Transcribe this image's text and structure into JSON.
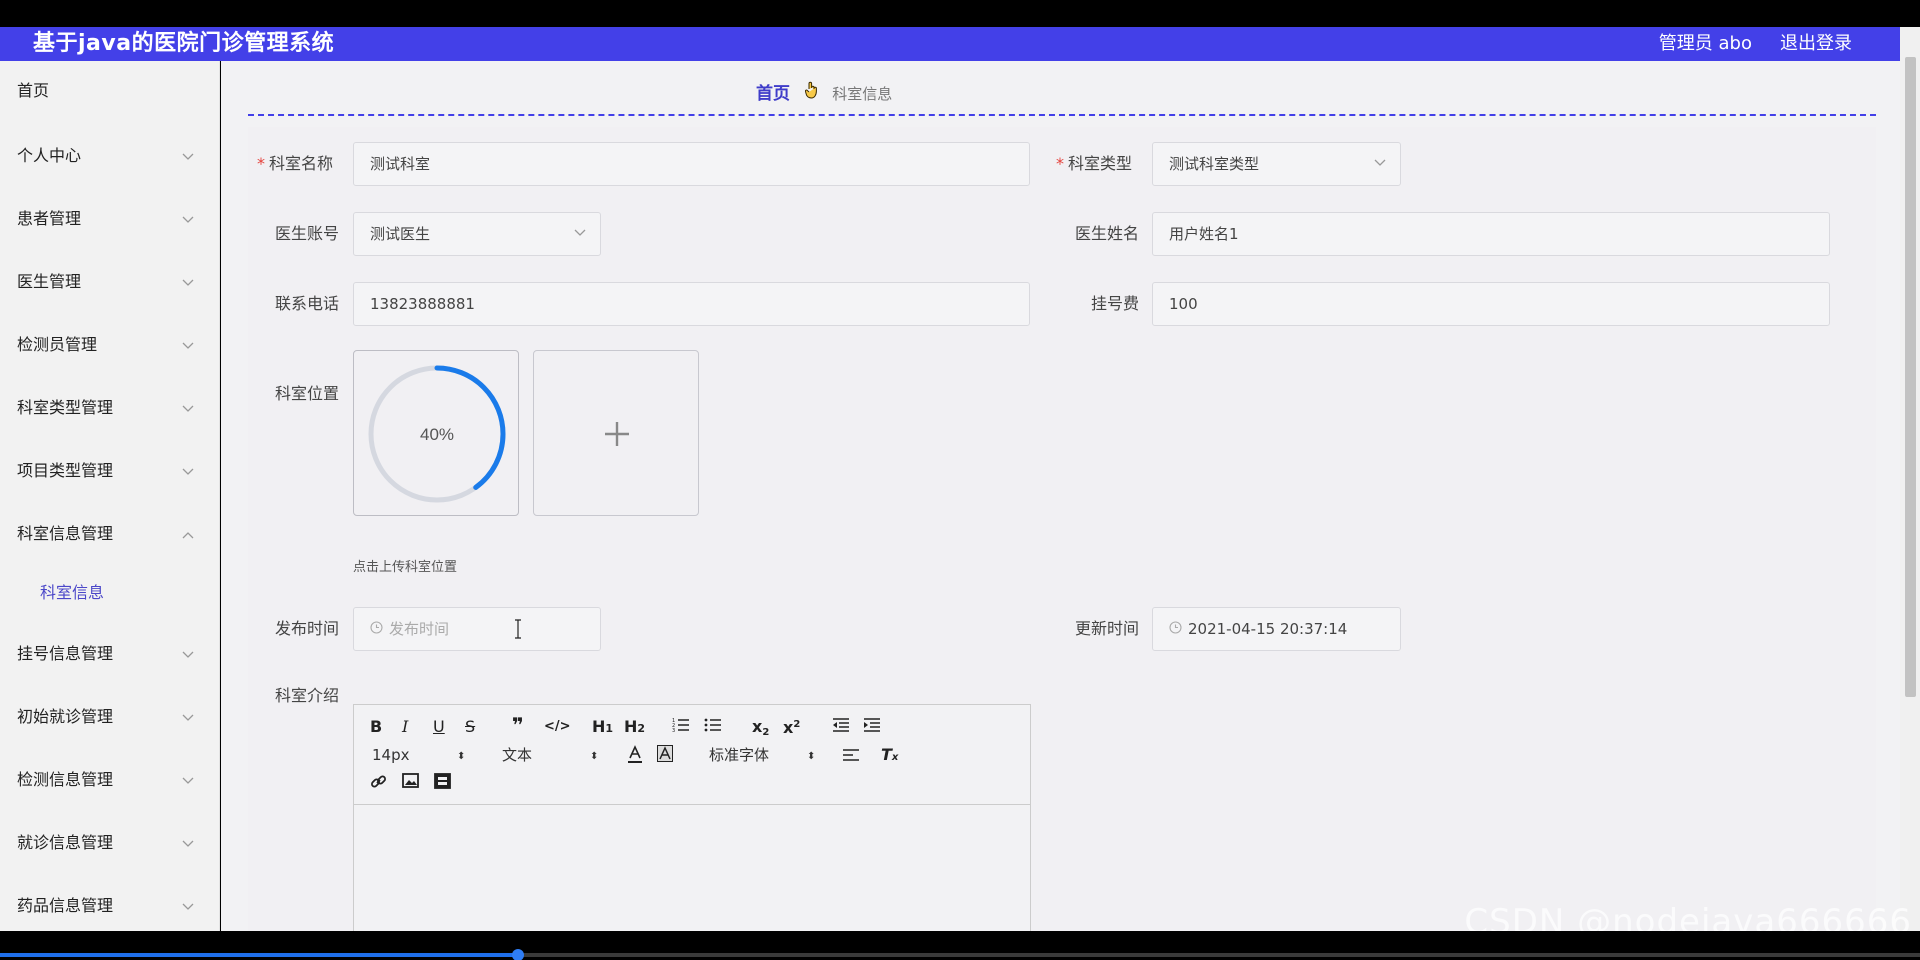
{
  "header": {
    "app_title": "基于java的医院门诊管理系统",
    "admin_label": "管理员 abo",
    "logout_label": "退出登录",
    "brand_color": "#4340e8"
  },
  "sidebar": {
    "items": [
      {
        "label": "首页",
        "expandable": false
      },
      {
        "label": "个人中心",
        "expandable": true
      },
      {
        "label": "患者管理",
        "expandable": true
      },
      {
        "label": "医生管理",
        "expandable": true
      },
      {
        "label": "检测员管理",
        "expandable": true
      },
      {
        "label": "科室类型管理",
        "expandable": true
      },
      {
        "label": "项目类型管理",
        "expandable": true
      },
      {
        "label": "科室信息管理",
        "expandable": true,
        "expanded": true
      },
      {
        "label": "科室信息",
        "sub": true
      },
      {
        "label": "挂号信息管理",
        "expandable": true
      },
      {
        "label": "初始就诊管理",
        "expandable": true
      },
      {
        "label": "检测信息管理",
        "expandable": true
      },
      {
        "label": "就诊信息管理",
        "expandable": true
      },
      {
        "label": "药品信息管理",
        "expandable": true
      }
    ]
  },
  "breadcrumb": {
    "home": "首页",
    "current": "科室信息"
  },
  "form": {
    "dept_name": {
      "label": "科室名称",
      "required": true,
      "value": "测试科室"
    },
    "dept_type": {
      "label": "科室类型",
      "required": true,
      "value": "测试科室类型"
    },
    "doctor_account": {
      "label": "医生账号",
      "value": "测试医生"
    },
    "doctor_name": {
      "label": "医生姓名",
      "value": "用户姓名1"
    },
    "phone": {
      "label": "联系电话",
      "value": "13823888881"
    },
    "fee": {
      "label": "挂号费",
      "value": "100"
    },
    "location": {
      "label": "科室位置",
      "upload_progress_text": "40%",
      "upload_progress": 0.4,
      "tip": "点击上传科室位置"
    },
    "publish_time": {
      "label": "发布时间",
      "placeholder": "发布时间"
    },
    "update_time": {
      "label": "更新时间",
      "value": "2021-04-15 20:37:14"
    },
    "intro": {
      "label": "科室介绍"
    }
  },
  "editor_toolbar": {
    "font_size": "14px",
    "text_style": "文本",
    "font_family": "标准字体",
    "buttons": [
      "bold-icon",
      "italic-icon",
      "underline-icon",
      "strikethrough-icon",
      "blockquote-icon",
      "code-icon",
      "h1-icon",
      "h2-icon",
      "ordered-list-icon",
      "bullet-list-icon",
      "subscript-icon",
      "superscript-icon",
      "outdent-icon",
      "indent-icon",
      "font-color-icon",
      "background-color-icon",
      "align-icon",
      "clear-format-icon",
      "link-icon",
      "image-icon",
      "video-icon"
    ]
  },
  "watermark": "CSDN @nodejava666666",
  "video": {
    "progress": 0.27
  }
}
